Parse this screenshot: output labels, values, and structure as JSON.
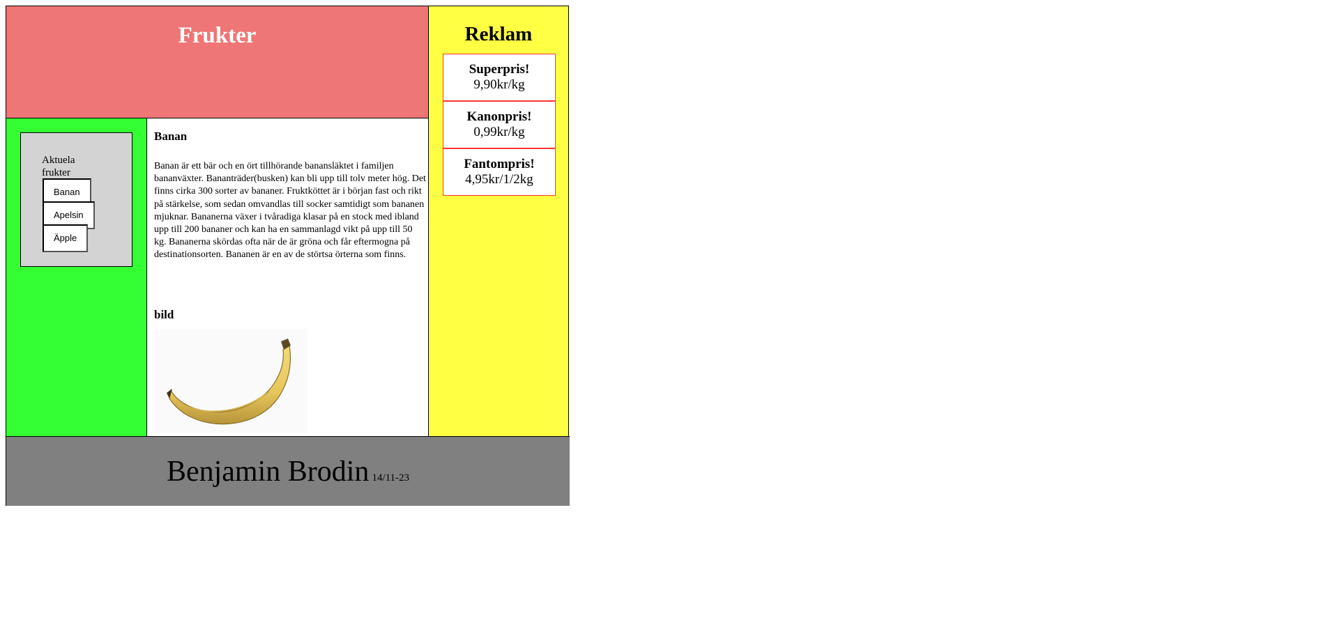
{
  "header": {
    "title": "Frukter"
  },
  "ads": {
    "title": "Reklam",
    "items": [
      {
        "title": "Superpris!",
        "price": "9,90kr/kg"
      },
      {
        "title": "Kanonpris!",
        "price": "0,99kr/kg"
      },
      {
        "title": "Fantompris!",
        "price": "4,95kr/1/2kg"
      }
    ]
  },
  "nav": {
    "label": "Aktuela frukter",
    "buttons": [
      "Banan",
      "Apelsin",
      "Äpple"
    ]
  },
  "content": {
    "heading": "Banan",
    "text": "Banan är ett bär och en ört tillhörande banansläktet i familjen bananväxter. Bananträder(busken) kan bli upp till tolv meter hög. Det finns cirka 300 sorter av bananer. Fruktköttet är i början fast och rikt på stärkelse, som sedan omvandlas till socker samtidigt som bananen mjuknar. Bananerna växer i tvåradiga klasar på en stock med ibland upp till 200 bananer och kan ha en sammanlagd vikt på upp till 50 kg. Bananerna skördas ofta när de är gröna och får eftermogna på destinationsorten. Bananen är en av de störtsa örterna som finns.",
    "image_heading": "bild"
  },
  "footer": {
    "name": "Benjamin Brodin",
    "date": "14/11-23"
  },
  "colors": {
    "header_bg": "#ee7676",
    "ads_bg": "#ffff44",
    "nav_bg": "#33ff33",
    "nav_box_bg": "#d3d3d3",
    "footer_bg": "#808080",
    "ad_border": "#ff3333"
  }
}
